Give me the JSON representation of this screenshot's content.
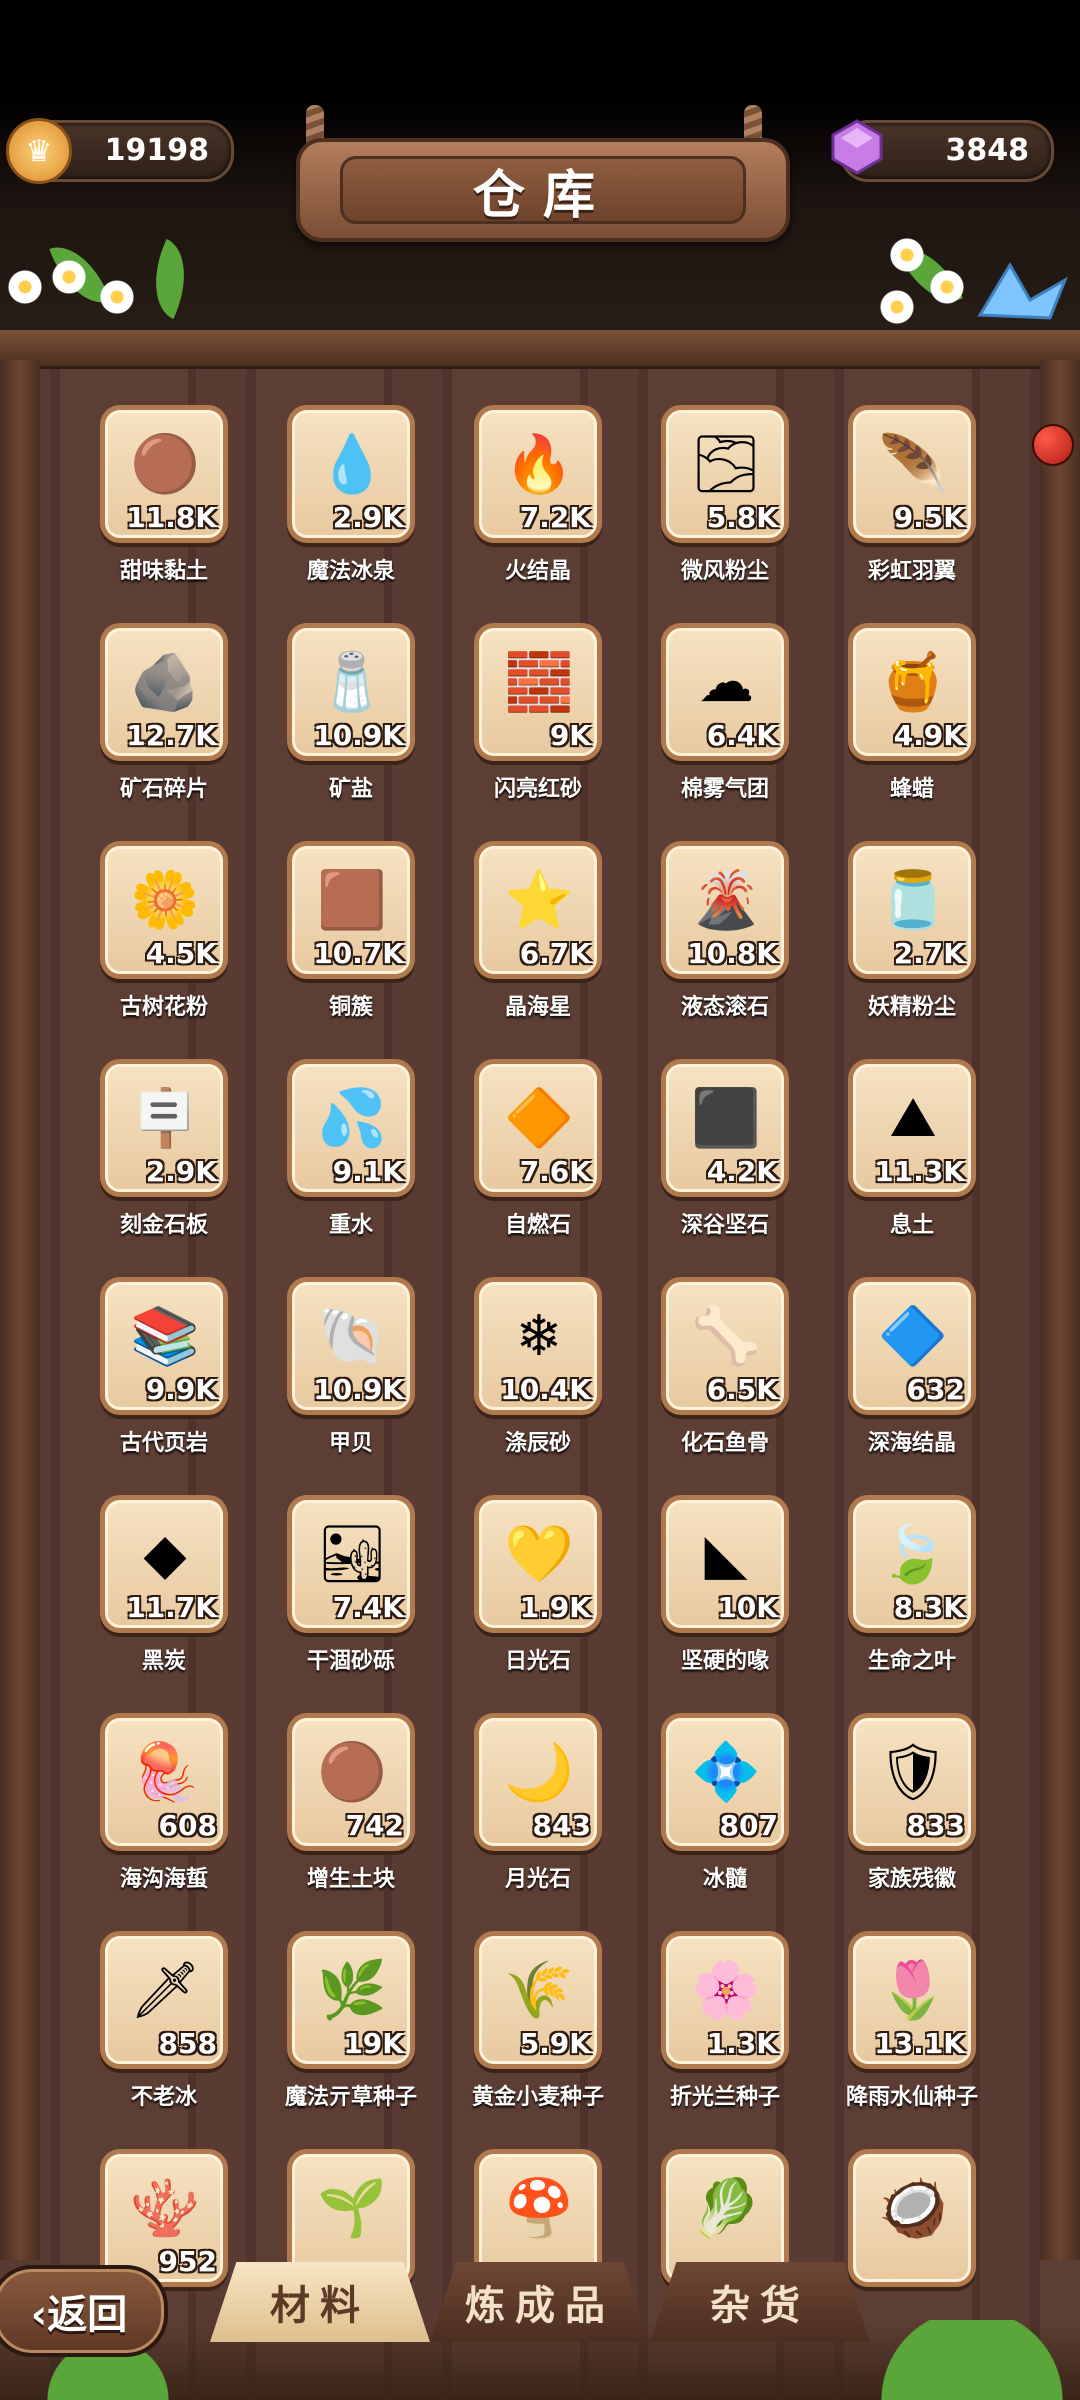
{
  "header": {
    "title": "仓库",
    "coins": "19198",
    "gems": "3848"
  },
  "items": [
    {
      "name": "甜味黏土",
      "count": "11.8K",
      "icon": "clay-icon",
      "glyph": "🟤"
    },
    {
      "name": "魔法冰泉",
      "count": "2.9K",
      "icon": "spring-icon",
      "glyph": "💧"
    },
    {
      "name": "火结晶",
      "count": "7.2K",
      "icon": "fire-crystal-icon",
      "glyph": "🔥"
    },
    {
      "name": "微风粉尘",
      "count": "5.8K",
      "icon": "dust-icon",
      "glyph": "🌫"
    },
    {
      "name": "彩虹羽翼",
      "count": "9.5K",
      "icon": "feather-icon",
      "glyph": "🪶"
    },
    {
      "name": "矿石碎片",
      "count": "12.7K",
      "icon": "ore-icon",
      "glyph": "🪨"
    },
    {
      "name": "矿盐",
      "count": "10.9K",
      "icon": "salt-icon",
      "glyph": "🧂"
    },
    {
      "name": "闪亮红砂",
      "count": "9K",
      "icon": "red-sand-icon",
      "glyph": "🧱"
    },
    {
      "name": "棉雾气团",
      "count": "6.4K",
      "icon": "cloud-icon",
      "glyph": "☁"
    },
    {
      "name": "蜂蜡",
      "count": "4.9K",
      "icon": "beeswax-icon",
      "glyph": "🍯"
    },
    {
      "name": "古树花粉",
      "count": "4.5K",
      "icon": "pollen-icon",
      "glyph": "🌼"
    },
    {
      "name": "铜簇",
      "count": "10.7K",
      "icon": "copper-icon",
      "glyph": "🟫"
    },
    {
      "name": "晶海星",
      "count": "6.7K",
      "icon": "starfish-icon",
      "glyph": "⭐"
    },
    {
      "name": "液态滚石",
      "count": "10.8K",
      "icon": "lava-rock-icon",
      "glyph": "🌋"
    },
    {
      "name": "妖精粉尘",
      "count": "2.7K",
      "icon": "fairy-jar-icon",
      "glyph": "🫙"
    },
    {
      "name": "刻金石板",
      "count": "2.9K",
      "icon": "slate-icon",
      "glyph": "🪧"
    },
    {
      "name": "重水",
      "count": "9.1K",
      "icon": "water-icon",
      "glyph": "💦"
    },
    {
      "name": "自燃石",
      "count": "7.6K",
      "icon": "ember-stone-icon",
      "glyph": "🔶"
    },
    {
      "name": "深谷坚石",
      "count": "4.2K",
      "icon": "hard-stone-icon",
      "glyph": "⬛"
    },
    {
      "name": "息土",
      "count": "11.3K",
      "icon": "soil-icon",
      "glyph": "⛰"
    },
    {
      "name": "古代页岩",
      "count": "9.9K",
      "icon": "shale-icon",
      "glyph": "📚"
    },
    {
      "name": "甲贝",
      "count": "10.9K",
      "icon": "shell-icon",
      "glyph": "🐚"
    },
    {
      "name": "涤辰砂",
      "count": "10.4K",
      "icon": "coral-sand-icon",
      "glyph": "❄"
    },
    {
      "name": "化石鱼骨",
      "count": "6.5K",
      "icon": "fishbone-icon",
      "glyph": "🦴"
    },
    {
      "name": "深海结晶",
      "count": "632",
      "icon": "sea-crystal-icon",
      "glyph": "🔷"
    },
    {
      "name": "黑炭",
      "count": "11.7K",
      "icon": "charcoal-icon",
      "glyph": "◆"
    },
    {
      "name": "干涸砂砾",
      "count": "7.4K",
      "icon": "gravel-icon",
      "glyph": "🏜"
    },
    {
      "name": "日光石",
      "count": "1.9K",
      "icon": "sunstone-icon",
      "glyph": "💛"
    },
    {
      "name": "坚硬的喙",
      "count": "10K",
      "icon": "beak-icon",
      "glyph": "◣"
    },
    {
      "name": "生命之叶",
      "count": "8.3K",
      "icon": "life-leaf-icon",
      "glyph": "🍃"
    },
    {
      "name": "海沟海蜇",
      "count": "608",
      "icon": "jellyfish-icon",
      "glyph": "🪼"
    },
    {
      "name": "增生土块",
      "count": "742",
      "icon": "dirt-clod-icon",
      "glyph": "🟤"
    },
    {
      "name": "月光石",
      "count": "843",
      "icon": "moonstone-icon",
      "glyph": "🌙"
    },
    {
      "name": "冰髓",
      "count": "807",
      "icon": "ice-marrow-icon",
      "glyph": "💠"
    },
    {
      "name": "家族残徽",
      "count": "833",
      "icon": "crest-icon",
      "glyph": "🛡"
    },
    {
      "name": "不老冰",
      "count": "858",
      "icon": "ageless-ice-icon",
      "glyph": "🗡"
    },
    {
      "name": "魔法亓草种子",
      "count": "19K",
      "icon": "herb-seed-icon",
      "glyph": "🌿"
    },
    {
      "name": "黄金小麦种子",
      "count": "5.9K",
      "icon": "wheat-seed-icon",
      "glyph": "🌾"
    },
    {
      "name": "折光兰种子",
      "count": "1.3K",
      "icon": "orchid-seed-icon",
      "glyph": "🌸"
    },
    {
      "name": "降雨水仙种子",
      "count": "13.1K",
      "icon": "daffodil-seed-icon",
      "glyph": "🌷"
    },
    {
      "name": "",
      "count": "952",
      "icon": "coral-icon",
      "glyph": "🪸"
    },
    {
      "name": "",
      "count": "",
      "icon": "dark-plant-icon",
      "glyph": "🌱"
    },
    {
      "name": "",
      "count": "",
      "icon": "red-coral-icon",
      "glyph": "🍄"
    },
    {
      "name": "",
      "count": "",
      "icon": "turnip-icon",
      "glyph": "🥬"
    },
    {
      "name": "",
      "count": "",
      "icon": "coconut-icon",
      "glyph": "🥥"
    }
  ],
  "footer": {
    "back_label": "‹返回",
    "tabs": [
      "材料",
      "炼成品",
      "杂货"
    ]
  }
}
